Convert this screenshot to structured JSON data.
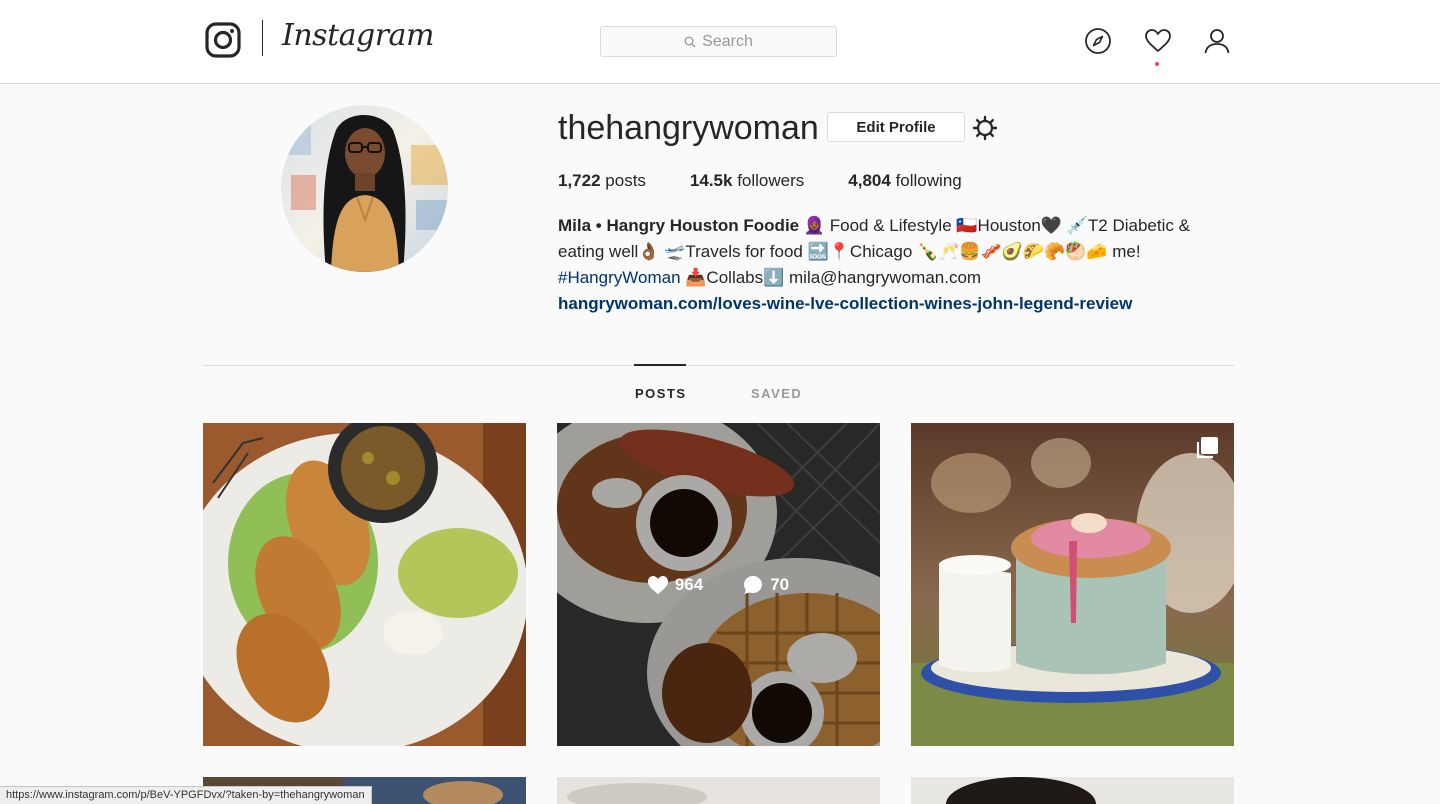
{
  "header": {
    "brand": "Instagram",
    "search_placeholder": "Search"
  },
  "profile": {
    "username": "thehangrywoman",
    "edit_label": "Edit Profile",
    "stats": {
      "posts_count": "1,722",
      "posts_label": "posts",
      "followers_count": "14.5k",
      "followers_label": "followers",
      "following_count": "4,804",
      "following_label": "following"
    },
    "bio": {
      "name": "Mila • Hangry Houston Foodie",
      "line1_rest": "🧕🏾 Food & Lifestyle 🇨🇱Houston🖤 💉T2 Diabetic &",
      "line2": "eating well👌🏾 🛫Travels for food 🔜📍Chicago 🍾🥂🍔🥓🥑🌮🥐🥙🧀 me!",
      "hashtag": "#HangryWoman",
      "line3_rest": "📥Collabs⬇️ mila@hangrywoman.com",
      "link": "hangrywoman.com/loves-wine-lve-collection-wines-john-legend-review"
    }
  },
  "tabs": {
    "posts": "POSTS",
    "saved": "SAVED"
  },
  "posts": [
    {
      "subject": "tacos"
    },
    {
      "subject": "chicken and waffles",
      "likes": "964",
      "comments": "70"
    },
    {
      "subject": "souffle"
    }
  ],
  "status_bar": {
    "url": "https://www.instagram.com/p/BeV-YPGFDvx/?taken-by=thehangrywoman"
  }
}
